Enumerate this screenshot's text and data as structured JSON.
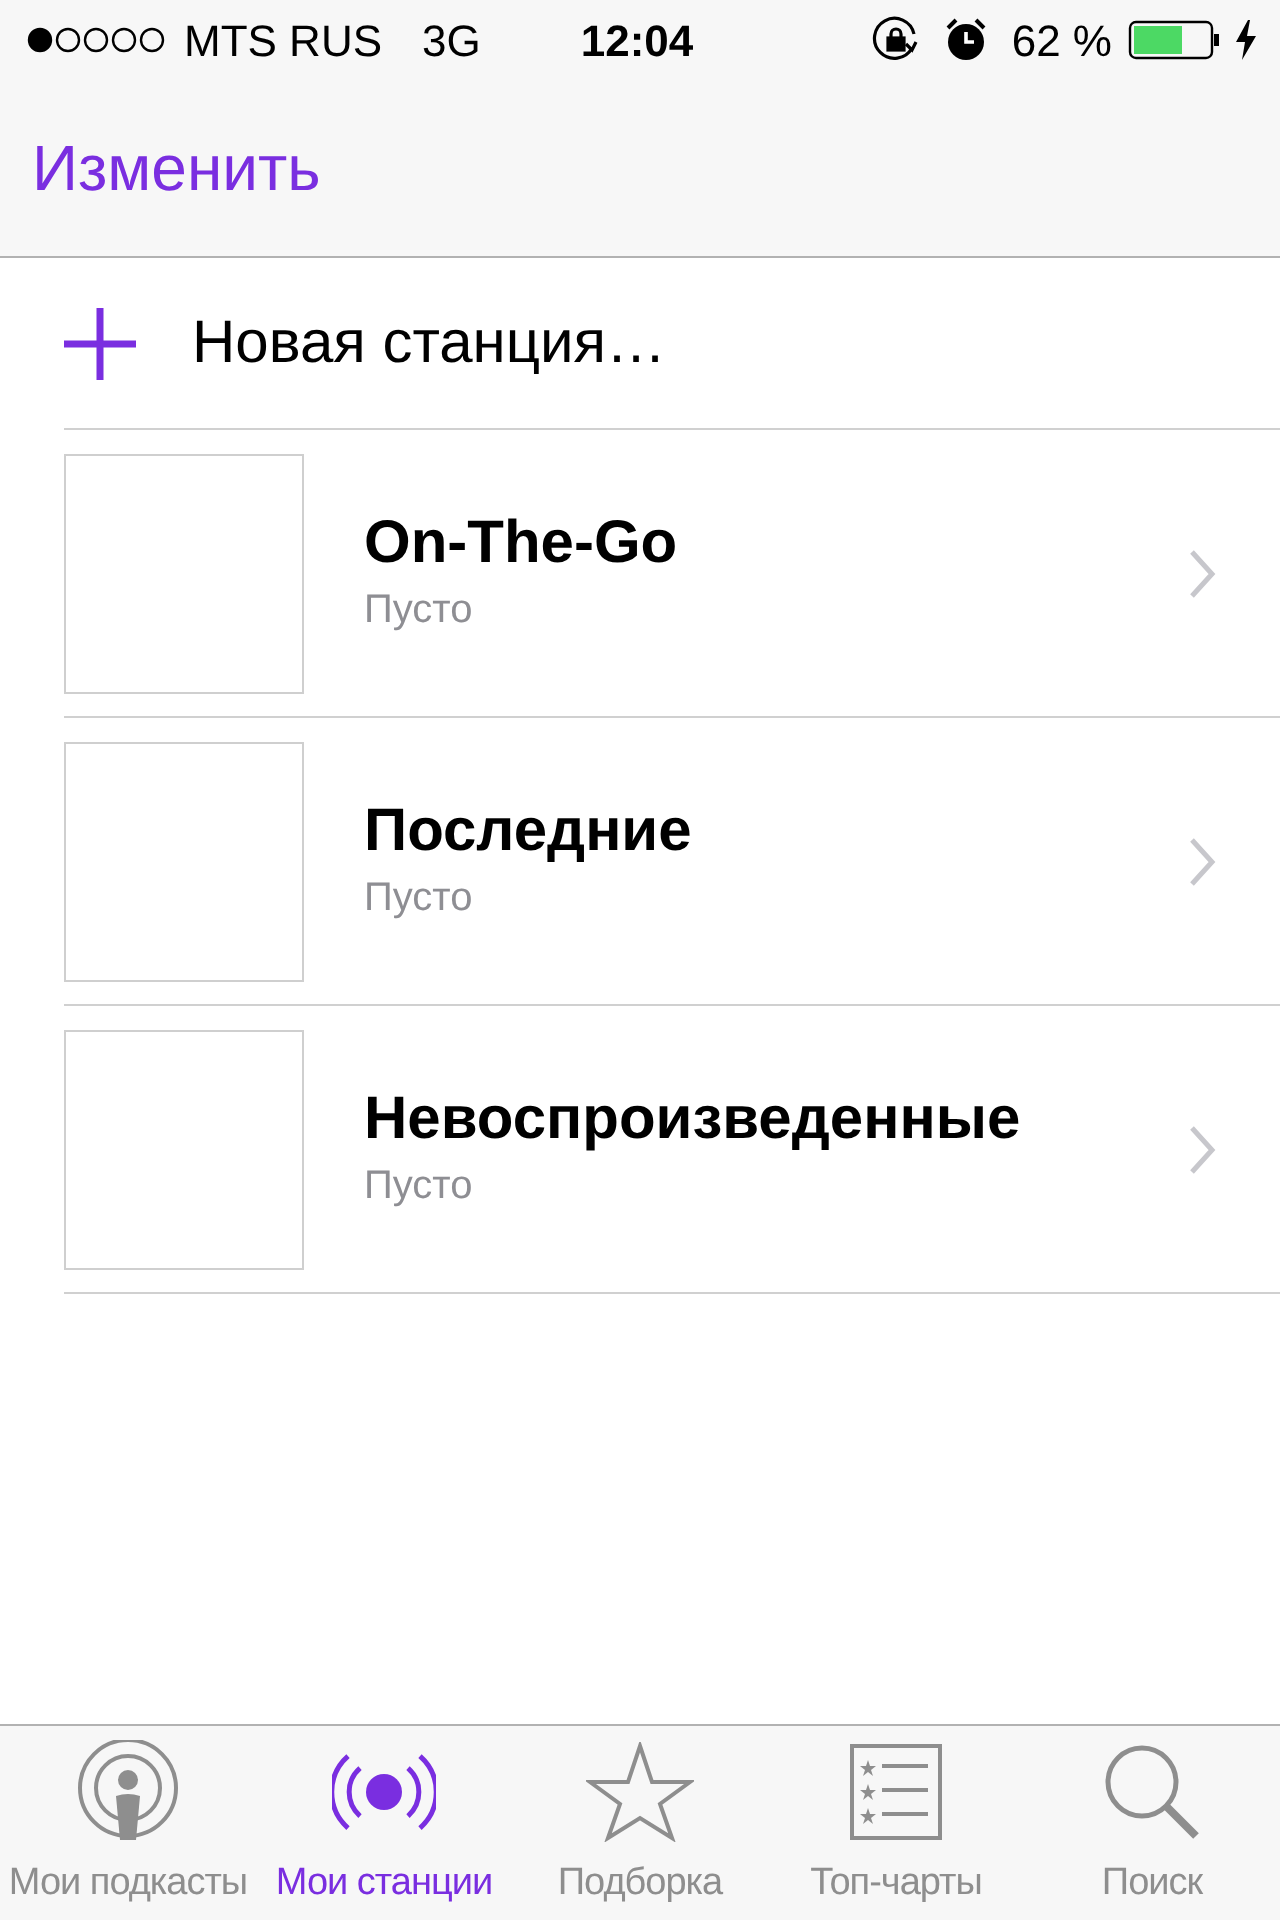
{
  "status_bar": {
    "carrier": "MTS RUS",
    "network": "3G",
    "time": "12:04",
    "battery": "62 %"
  },
  "nav": {
    "edit": "Изменить"
  },
  "new_station": {
    "label": "Новая станция…"
  },
  "stations": [
    {
      "title": "On-The-Go",
      "subtitle": "Пусто"
    },
    {
      "title": "Последние",
      "subtitle": "Пусто"
    },
    {
      "title": "Невоспроизведенные",
      "subtitle": "Пусто"
    }
  ],
  "tabs": [
    {
      "kind": "podcasts",
      "label": "Мои подкасты",
      "selected": false
    },
    {
      "kind": "stations",
      "label": "Мои станции",
      "selected": true
    },
    {
      "kind": "featured",
      "label": "Подборка",
      "selected": false
    },
    {
      "kind": "charts",
      "label": "Топ-чарты",
      "selected": false
    },
    {
      "kind": "search",
      "label": "Поиск",
      "selected": false
    }
  ]
}
